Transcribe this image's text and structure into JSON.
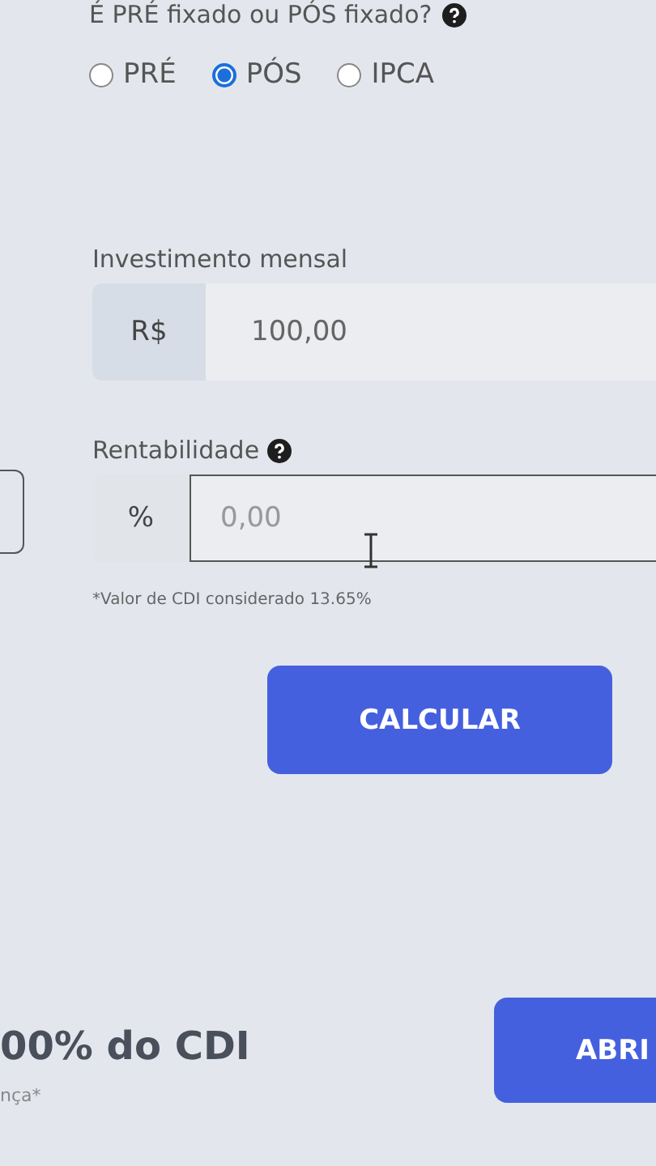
{
  "question": {
    "label": "É PRÉ fixado ou PÓS fixado?"
  },
  "options": [
    {
      "label": "PRÉ",
      "selected": false
    },
    {
      "label": "PÓS",
      "selected": true
    },
    {
      "label": "IPCA",
      "selected": false
    }
  ],
  "monthly": {
    "label": "Investimento mensal",
    "prefix": "R$",
    "value": "100,00"
  },
  "rate": {
    "label": "Rentabilidade",
    "prefix": "%",
    "placeholder": "0,00",
    "focused": true
  },
  "note": "*Valor de CDI considerado 13.65%",
  "calculate_button": "CALCULAR",
  "result": {
    "value": "00% do CDI",
    "footnote": "nça*"
  },
  "open_button": "ABRI"
}
